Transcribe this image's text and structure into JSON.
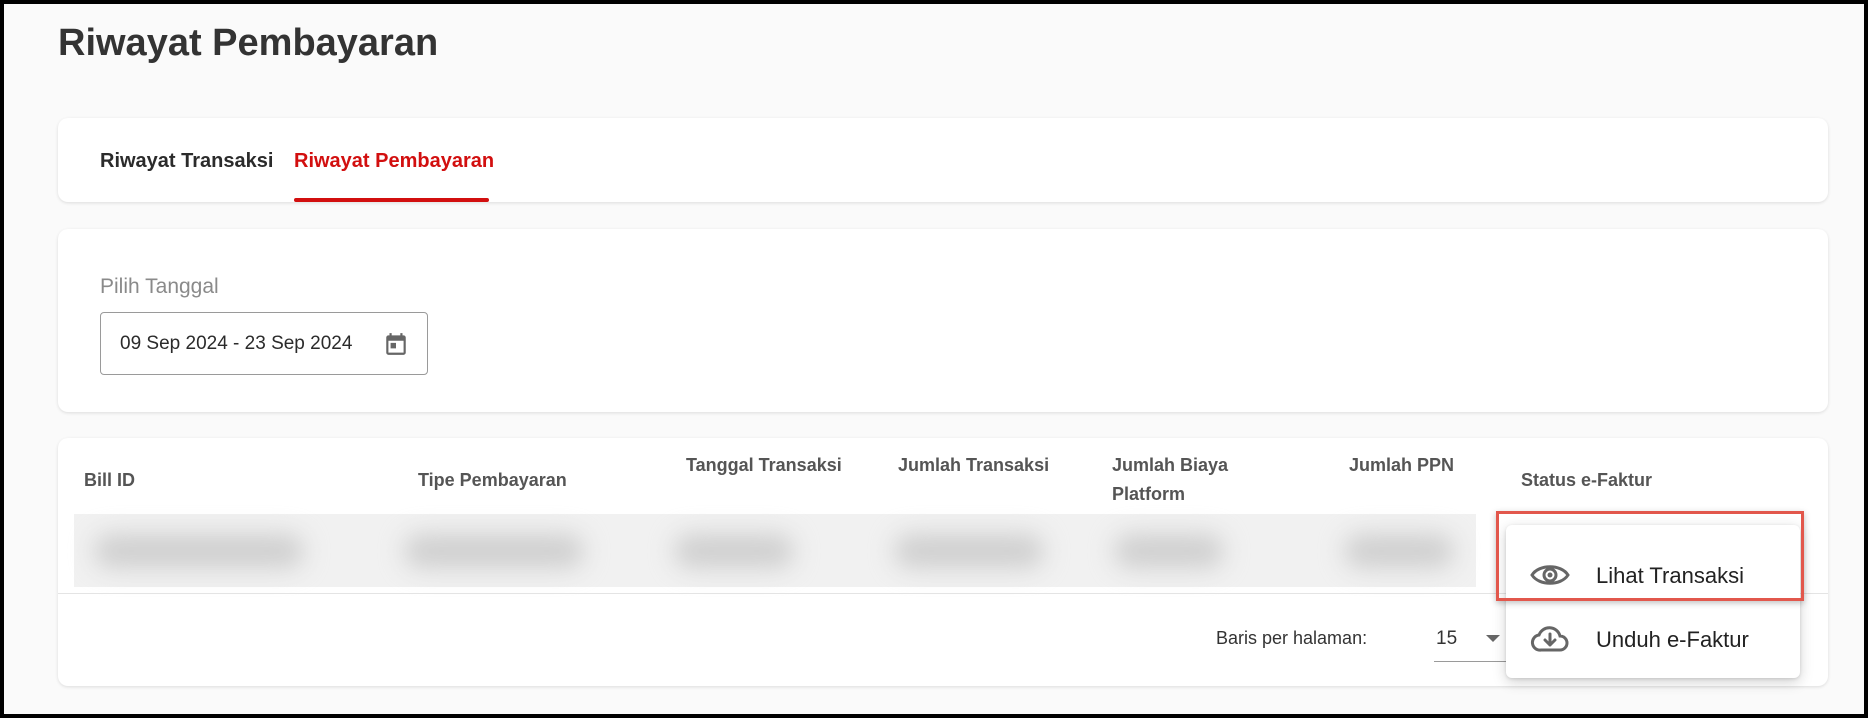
{
  "page": {
    "title": "Riwayat Pembayaran"
  },
  "tabs": [
    {
      "label": "Riwayat Transaksi",
      "active": false
    },
    {
      "label": "Riwayat Pembayaran",
      "active": true
    }
  ],
  "filter": {
    "label": "Pilih Tanggal",
    "date_range": "09 Sep 2024 - 23 Sep 2024",
    "icon": "calendar-icon"
  },
  "table": {
    "headers": {
      "bill_id": "Bill ID",
      "tipe_pembayaran": "Tipe Pembayaran",
      "tanggal_transaksi": "Tanggal Transaksi",
      "jumlah_transaksi": "Jumlah Transaksi",
      "jumlah_biaya_platform_line1": "Jumlah Biaya",
      "jumlah_biaya_platform_line2": "Platform",
      "jumlah_ppn": "Jumlah PPN",
      "status_efaktur": "Status e-Faktur"
    }
  },
  "pagination": {
    "rows_per_page_label": "Baris per halaman:",
    "rows_per_page_value": "15"
  },
  "menu": {
    "items": [
      {
        "label": "Lihat Transaksi",
        "icon": "eye-icon"
      },
      {
        "label": "Unduh e-Faktur",
        "icon": "cloud-download-icon"
      }
    ]
  },
  "colors": {
    "accent": "#d20f0f",
    "highlight": "#e2574c",
    "background": "#fafafa"
  }
}
